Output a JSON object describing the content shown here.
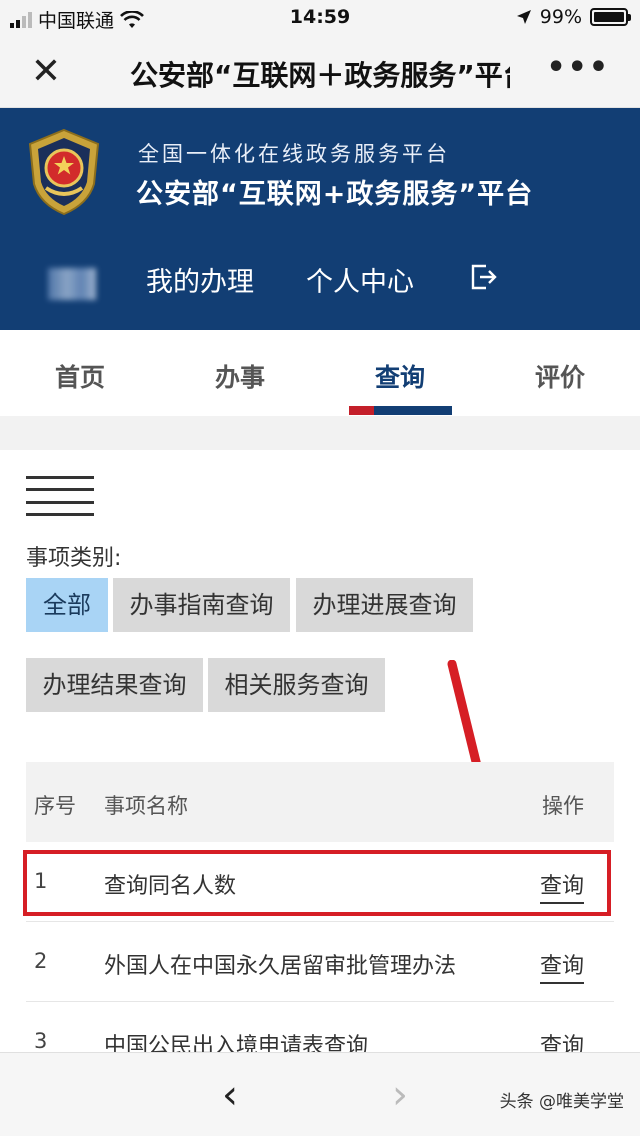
{
  "status_bar": {
    "carrier": "中国联通",
    "time": "14:59",
    "battery": "99%"
  },
  "nav": {
    "title": "公安部“互联网＋政务服务”平台",
    "close_icon": "close-icon",
    "more_icon": "more-icon"
  },
  "header": {
    "subtitle": "全国一体化在线政务服务平台",
    "title": "公安部“互联网+政务服务”平台",
    "links": [
      "我的办理",
      "个人中心"
    ],
    "colors": {
      "background": "#123e74"
    }
  },
  "tabs": [
    {
      "label": "首页"
    },
    {
      "label": "办事"
    },
    {
      "label": "查询",
      "active": true
    },
    {
      "label": "评价"
    }
  ],
  "category": {
    "label": "事项类别:",
    "chips": [
      {
        "label": "全部",
        "active": true
      },
      {
        "label": "办事指南查询"
      },
      {
        "label": "办理进展查询"
      },
      {
        "label": "办理结果查询"
      },
      {
        "label": "相关服务查询"
      }
    ]
  },
  "table": {
    "headers": [
      "序号",
      "事项名称",
      "操作"
    ],
    "rows": [
      {
        "no": "1",
        "name": "查询同名人数",
        "action": "查询"
      },
      {
        "no": "2",
        "name": "外国人在中国永久居留审批管理办法",
        "action": "查询"
      },
      {
        "no": "3",
        "name": "中国公民出入境申请表查询",
        "action": "查询"
      }
    ]
  },
  "watermark": "头条 @唯美学堂",
  "accent_colors": {
    "highlight_red": "#d61e25",
    "chip_active": "#a9d4f5",
    "tab_red": "#c41f2a"
  }
}
